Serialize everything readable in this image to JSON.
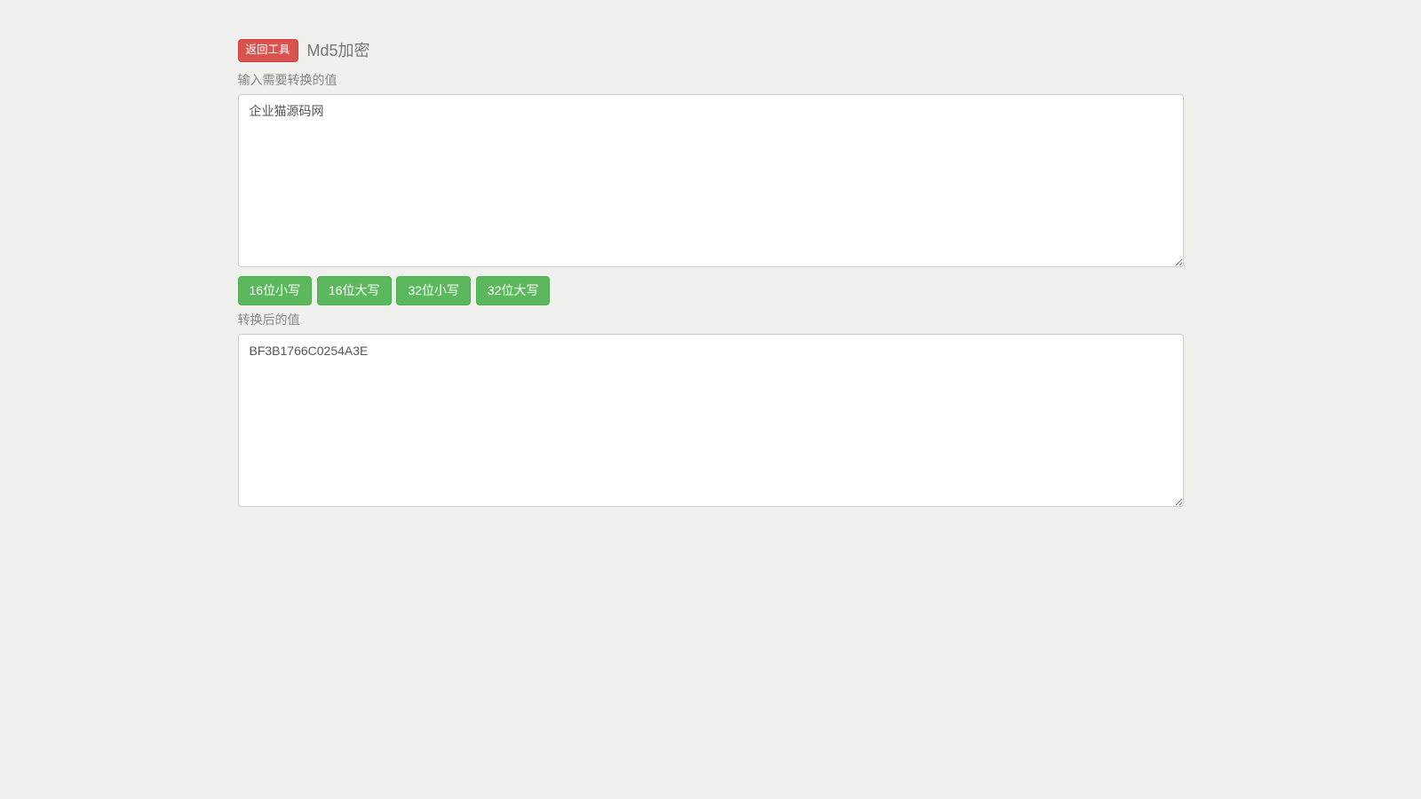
{
  "header": {
    "back_button": "返回工具",
    "title": "Md5加密"
  },
  "input_section": {
    "label": "输入需要转换的值",
    "value": "企业猫源码网"
  },
  "buttons": {
    "btn_16_lower": "16位小写",
    "btn_16_upper": "16位大写",
    "btn_32_lower": "32位小写",
    "btn_32_upper": "32位大写"
  },
  "output_section": {
    "label": "转换后的值",
    "value": "BF3B1766C0254A3E"
  }
}
